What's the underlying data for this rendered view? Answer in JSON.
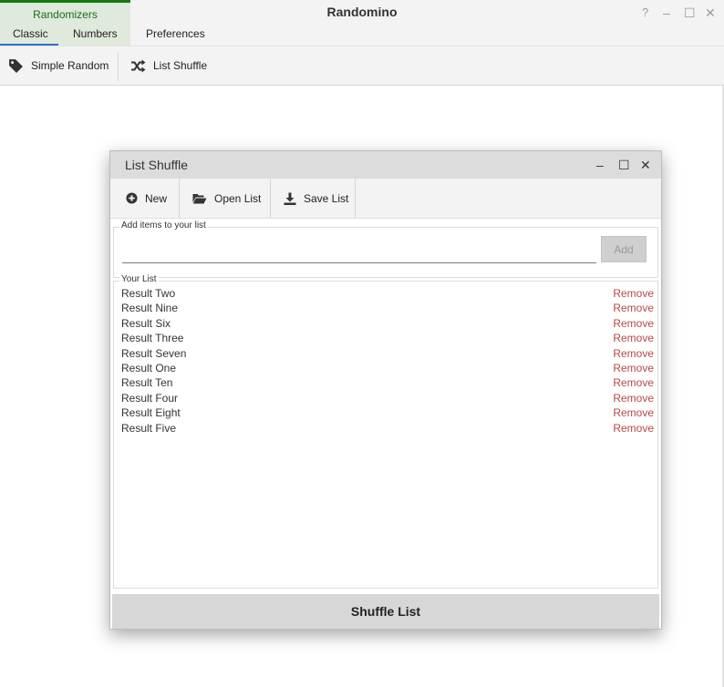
{
  "app": {
    "title": "Randomino",
    "group_label": "Randomizers",
    "tabs": [
      {
        "label": "Classic",
        "selected": true
      },
      {
        "label": "Numbers",
        "selected": false
      },
      {
        "label": "Preferences",
        "selected": false
      }
    ],
    "window_controls": {
      "help": "?",
      "minimize": "–",
      "maximize": "☐",
      "close": "✕"
    }
  },
  "commands": {
    "simple_random": {
      "label": "Simple Random",
      "icon": "tag-icon"
    },
    "list_shuffle": {
      "label": "List Shuffle",
      "icon": "shuffle-icon"
    }
  },
  "dialog": {
    "title": "List Shuffle",
    "controls": {
      "minimize": "–",
      "maximize": "☐",
      "close": "✕"
    },
    "toolbar": {
      "new": {
        "label": "New",
        "icon": "plus-circle-icon"
      },
      "open": {
        "label": "Open List",
        "icon": "folder-open-icon"
      },
      "save": {
        "label": "Save List",
        "icon": "download-icon"
      }
    },
    "add_section": {
      "legend": "Add items to your list",
      "input_value": "",
      "add_label": "Add"
    },
    "list_section": {
      "legend": "Your List",
      "remove_label": "Remove",
      "items": [
        "Result Two",
        "Result Nine",
        "Result Six",
        "Result Three",
        "Result Seven",
        "Result One",
        "Result Ten",
        "Result Four",
        "Result Eight",
        "Result Five"
      ]
    },
    "shuffle_label": "Shuffle List"
  },
  "colors": {
    "accent_green": "#137a13",
    "remove_red": "#b5474a",
    "tab_underline": "#2f6fc4"
  }
}
